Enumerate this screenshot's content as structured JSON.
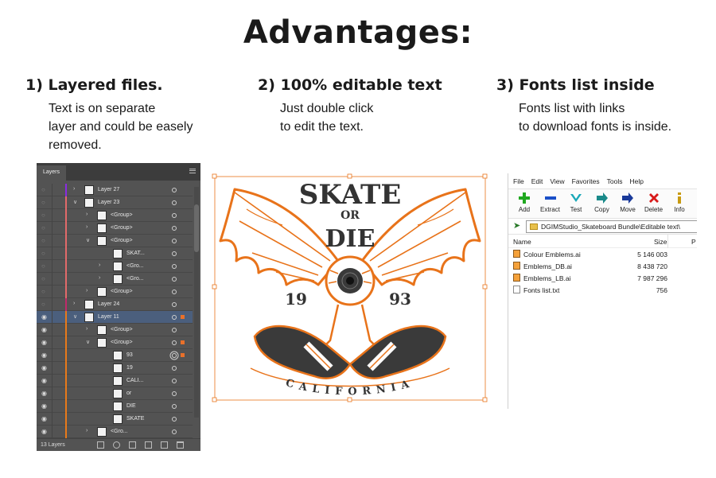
{
  "title": "Advantages:",
  "columns": [
    {
      "heading": "1) Layered files.",
      "lines": [
        "Text is on separate",
        "layer and could be easely",
        "removed."
      ]
    },
    {
      "heading": "2) 100% editable text",
      "lines": [
        "Just double click",
        "to edit the text."
      ]
    },
    {
      "heading": "3) Fonts list inside",
      "lines": [
        "Fonts list with links",
        "to download fonts is inside."
      ]
    }
  ],
  "layers_panel": {
    "tab": "Layers",
    "footer_count": "13 Layers",
    "rows": [
      {
        "name": "Layer 27",
        "level": 0,
        "arrow": ">",
        "eye": false,
        "color": "#8a2be2"
      },
      {
        "name": "Layer 23",
        "level": 0,
        "arrow": "v",
        "eye": false,
        "color": "#e26a6a"
      },
      {
        "name": "<Group>",
        "level": 1,
        "arrow": ">",
        "eye": false,
        "color": "#e26a6a"
      },
      {
        "name": "<Group>",
        "level": 1,
        "arrow": ">",
        "eye": false,
        "color": "#e26a6a"
      },
      {
        "name": "<Group>",
        "level": 1,
        "arrow": "v",
        "eye": false,
        "color": "#e26a6a"
      },
      {
        "name": "SKAT...",
        "level": 2,
        "arrow": "",
        "eye": false,
        "color": "#e26a6a"
      },
      {
        "name": "<Gro...",
        "level": 2,
        "arrow": ">",
        "eye": false,
        "color": "#e26a6a"
      },
      {
        "name": "<Gro...",
        "level": 2,
        "arrow": ">",
        "eye": false,
        "color": "#e26a6a"
      },
      {
        "name": "<Group>",
        "level": 1,
        "arrow": ">",
        "eye": false,
        "color": "#e26a6a"
      },
      {
        "name": "Layer 24",
        "level": 0,
        "arrow": ">",
        "eye": false,
        "color": "#c02a6a"
      },
      {
        "name": "Layer 11",
        "level": 0,
        "arrow": "v",
        "eye": true,
        "color": "#e87a1a",
        "selected": true
      },
      {
        "name": "<Group>",
        "level": 1,
        "arrow": ">",
        "eye": true,
        "color": "#e87a1a"
      },
      {
        "name": "<Group>",
        "level": 1,
        "arrow": "v",
        "eye": true,
        "color": "#e87a1a"
      },
      {
        "name": "93",
        "level": 2,
        "arrow": "",
        "eye": true,
        "color": "#e87a1a"
      },
      {
        "name": "19",
        "level": 2,
        "arrow": "",
        "eye": true,
        "color": "#e87a1a"
      },
      {
        "name": "CALI...",
        "level": 2,
        "arrow": "",
        "eye": true,
        "color": "#e87a1a"
      },
      {
        "name": "or",
        "level": 2,
        "arrow": "",
        "eye": true,
        "color": "#e87a1a"
      },
      {
        "name": "DIE",
        "level": 2,
        "arrow": "",
        "eye": true,
        "color": "#e87a1a"
      },
      {
        "name": "SKATE",
        "level": 2,
        "arrow": "",
        "eye": true,
        "color": "#e87a1a"
      },
      {
        "name": "<Gro...",
        "level": 1,
        "arrow": ">",
        "eye": true,
        "color": "#e87a1a"
      }
    ]
  },
  "artwork": {
    "top": "SKATE",
    "or": "OR",
    "die": "DIE",
    "year_left": "19",
    "year_right": "93",
    "banner": "CALIFORNIA",
    "accent": "#e8731a"
  },
  "archive": {
    "menu": [
      "File",
      "Edit",
      "View",
      "Favorites",
      "Tools",
      "Help"
    ],
    "toolbar": [
      {
        "label": "Add",
        "icon": "plus-icon",
        "color": "#1fa81f"
      },
      {
        "label": "Extract",
        "icon": "minus-icon",
        "color": "#1a4fc8"
      },
      {
        "label": "Test",
        "icon": "check-icon",
        "color": "#1aa8b8"
      },
      {
        "label": "Copy",
        "icon": "copy-arrow-icon",
        "color": "#1a8a8a"
      },
      {
        "label": "Move",
        "icon": "move-arrow-icon",
        "color": "#1a3a9a"
      },
      {
        "label": "Delete",
        "icon": "delete-x-icon",
        "color": "#d81a1a"
      },
      {
        "label": "Info",
        "icon": "info-icon",
        "color": "#c89a10"
      }
    ],
    "path": "DGIMStudio_Skateboard Bundle\\Editable text\\",
    "col_name": "Name",
    "col_size": "Size",
    "col_packed": "P",
    "files": [
      {
        "name": "Colour Emblems.ai",
        "size": "5 146 003",
        "type": "ai"
      },
      {
        "name": "Emblems_DB.ai",
        "size": "8 438 720",
        "type": "ai"
      },
      {
        "name": "Emblems_LB.ai",
        "size": "7 987 296",
        "type": "ai"
      },
      {
        "name": "Fonts list.txt",
        "size": "756",
        "type": "txt"
      }
    ]
  }
}
